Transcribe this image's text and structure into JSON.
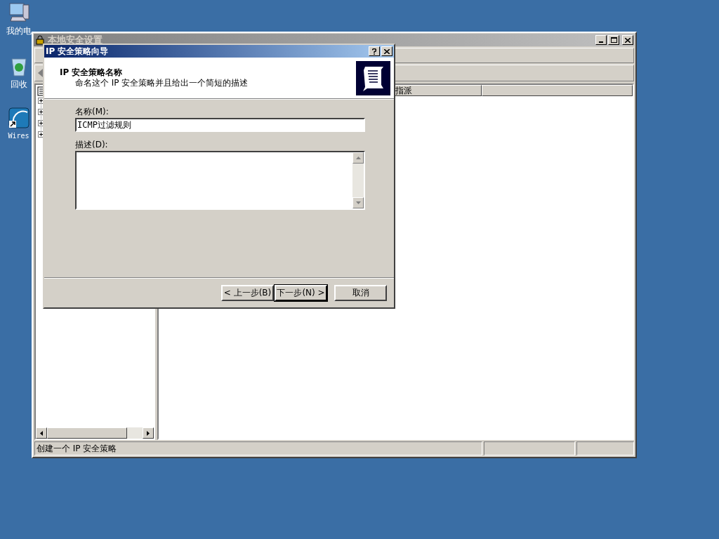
{
  "desktop_icons": [
    {
      "kind": "computer",
      "label": "我的电"
    },
    {
      "kind": "recycle",
      "label": "回收"
    },
    {
      "kind": "shortcut",
      "label": "Wires"
    }
  ],
  "main_window": {
    "title": "本地安全设置",
    "list_columns": [
      "指派"
    ],
    "tree_items": [
      {
        "expanded": false
      },
      {
        "expanded": false
      },
      {
        "expanded": false
      },
      {
        "expanded": false
      }
    ],
    "status_bar": {
      "text": "创建一个 IP 安全策略"
    }
  },
  "dialog": {
    "title": "IP 安全策略向导",
    "heading": "IP 安全策略名称",
    "subheading": "命名这个 IP 安全策略并且给出一个简短的描述",
    "name_label": "名称(M):",
    "name_value": "ICMP过滤规则",
    "description_label": "描述(D):",
    "buttons": [
      {
        "label": "< 上一步(B)",
        "default": false
      },
      {
        "label": "下一步(N) >",
        "default": true
      },
      {
        "label": "取消",
        "default": false
      }
    ]
  }
}
